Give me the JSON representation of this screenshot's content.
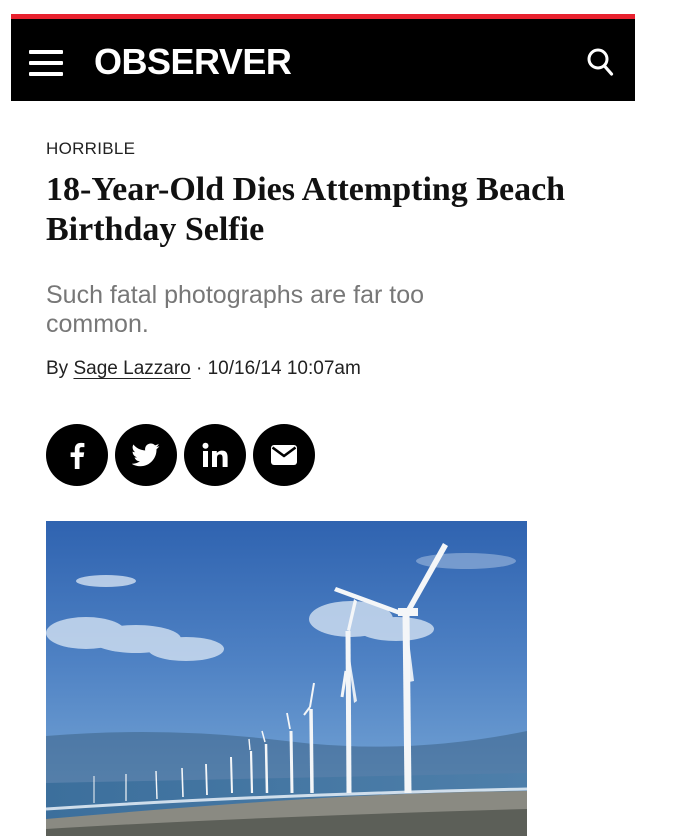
{
  "header": {
    "logo": "OBSERVER",
    "accent_color": "#e8212e",
    "background_color": "#000000",
    "menu_icon": "hamburger-menu-icon",
    "search_icon": "search-icon"
  },
  "article": {
    "kicker": "HORRIBLE",
    "title": "18-Year-Old Dies Attempting Beach Birthday Selfie",
    "dek": "Such fatal photographs are far too common.",
    "byline_prefix": "By",
    "author": "Sage Lazzaro",
    "separator": "·",
    "timestamp": "10/16/14 10:07am"
  },
  "share": {
    "buttons": [
      {
        "icon": "facebook-icon"
      },
      {
        "icon": "twitter-icon"
      },
      {
        "icon": "linkedin-icon"
      },
      {
        "icon": "email-icon"
      }
    ]
  },
  "hero_image": {
    "subject": "wind turbines along a beach under a blue sky"
  }
}
